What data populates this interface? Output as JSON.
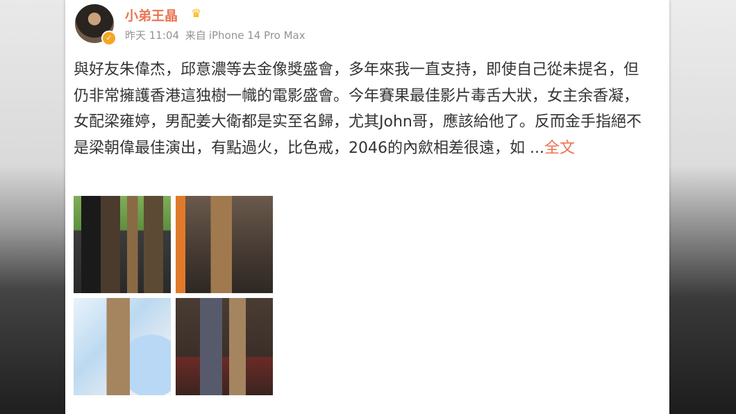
{
  "user": {
    "name": "小弟王晶",
    "badge_icon": "crown-icon",
    "verified_icon": "verified-icon",
    "verified_glyph": "✓",
    "crown_glyph": "♛"
  },
  "meta": {
    "time": "昨天 11:04",
    "source_prefix": "来自",
    "device": "iPhone 14 Pro Max"
  },
  "post": {
    "text": "與好友朱偉杰，邱意濃等去金像獎盛會，多年來我一直支持，即使自己從未提名，但仍非常擁護香港這独樹一幟的電影盛會。今年賽果最佳影片毒舌大狀，女主余香凝，女配梁雍婷，男配姜大衛都是实至名歸，尤其John哥，應該給他了。反而金手指絕不是梁朝偉最佳演出，有點過火，比色戒，2046的內歛相差很遠，如 ...",
    "more_label": "全文"
  },
  "photos": [
    {
      "alt": "photo-1"
    },
    {
      "alt": "photo-2"
    },
    {
      "alt": "photo-3"
    },
    {
      "alt": "photo-4"
    }
  ],
  "colors": {
    "name": "#eb7350",
    "meta": "#939393",
    "text": "#333333",
    "link": "#eb7350"
  }
}
